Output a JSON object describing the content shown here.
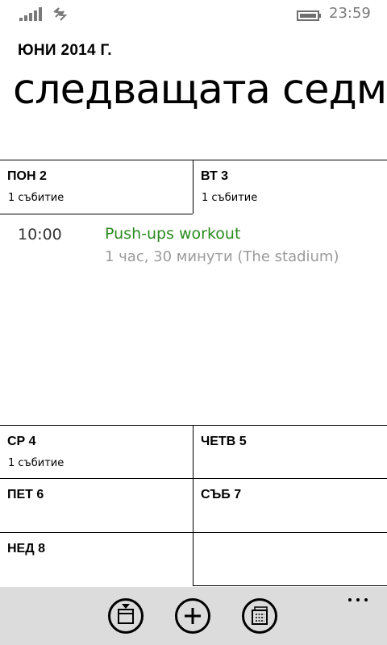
{
  "status_bar": {
    "time": "23:59",
    "signal_icon": "signal-strength-icon",
    "network_icon": "data-connection-icon",
    "battery_icon": "battery-icon"
  },
  "header": {
    "month": "ЮНИ 2014 Г.",
    "title": "следващата седмица"
  },
  "days": [
    {
      "name": "ПОН 2",
      "count": "1 събитие"
    },
    {
      "name": "ВТ 3",
      "count": "1 събитие"
    },
    {
      "name": "СР 4",
      "count": "1 събитие"
    },
    {
      "name": "ЧЕТВ 5",
      "count": ""
    },
    {
      "name": "ПЕТ 6",
      "count": ""
    },
    {
      "name": "СЪБ 7",
      "count": ""
    },
    {
      "name": "НЕД 8",
      "count": ""
    }
  ],
  "event": {
    "time": "10:00",
    "title": "Push-ups workout",
    "details": "1 час, 30 минути (The stadium)",
    "title_color": "#2a8a1f"
  },
  "app_bar": {
    "buttons": [
      {
        "icon": "today-icon"
      },
      {
        "icon": "add-icon"
      },
      {
        "icon": "month-view-icon"
      }
    ],
    "more_icon": "more-icon"
  }
}
